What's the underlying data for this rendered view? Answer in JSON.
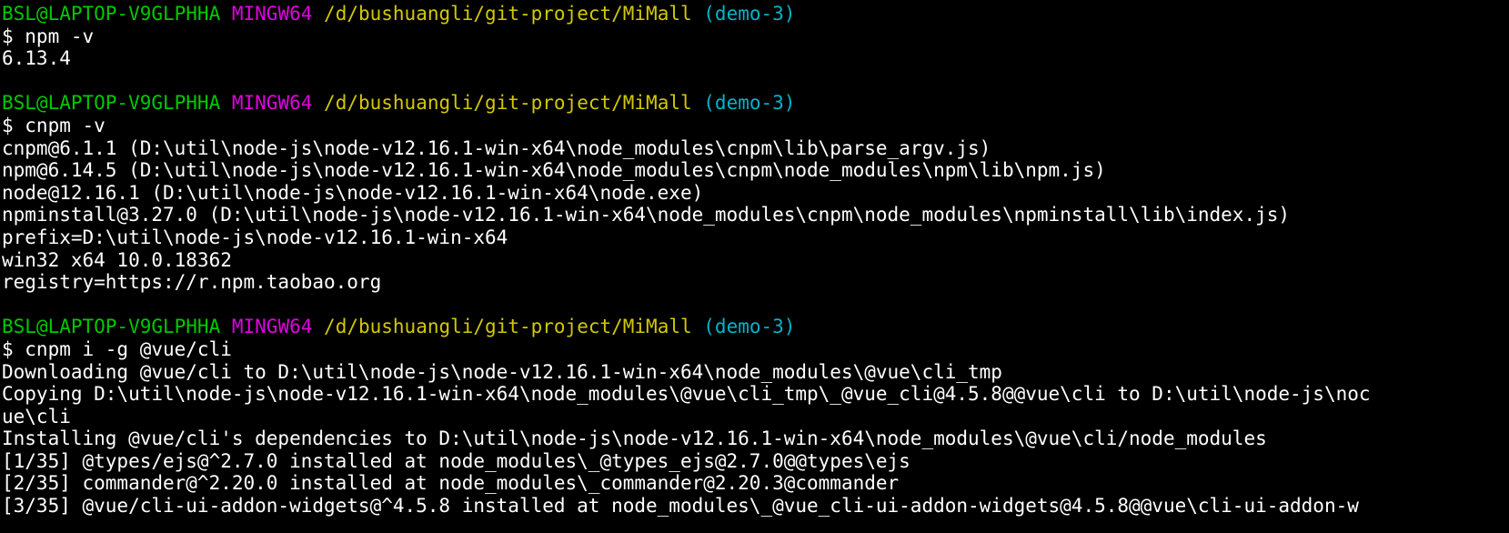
{
  "colors": {
    "background": "#000000",
    "prompt_user": "#00c800",
    "prompt_system": "#e000e0",
    "prompt_path": "#d2c800",
    "prompt_branch": "#00b4c8",
    "output_text": "#ffffff"
  },
  "blocks": [
    {
      "prompt": {
        "user": "BSL@LAPTOP-V9GLPHHA",
        "system": "MINGW64",
        "path": "/d/bushuangli/git-project/MiMall",
        "branch": "(demo-3)"
      },
      "command": "$ npm -v",
      "output": [
        "6.13.4"
      ]
    },
    {
      "prompt": {
        "user": "BSL@LAPTOP-V9GLPHHA",
        "system": "MINGW64",
        "path": "/d/bushuangli/git-project/MiMall",
        "branch": "(demo-3)"
      },
      "command": "$ cnpm -v",
      "output": [
        "cnpm@6.1.1 (D:\\util\\node-js\\node-v12.16.1-win-x64\\node_modules\\cnpm\\lib\\parse_argv.js)",
        "npm@6.14.5 (D:\\util\\node-js\\node-v12.16.1-win-x64\\node_modules\\cnpm\\node_modules\\npm\\lib\\npm.js)",
        "node@12.16.1 (D:\\util\\node-js\\node-v12.16.1-win-x64\\node.exe)",
        "npminstall@3.27.0 (D:\\util\\node-js\\node-v12.16.1-win-x64\\node_modules\\cnpm\\node_modules\\npminstall\\lib\\index.js)",
        "prefix=D:\\util\\node-js\\node-v12.16.1-win-x64",
        "win32 x64 10.0.18362",
        "registry=https://r.npm.taobao.org"
      ]
    },
    {
      "prompt": {
        "user": "BSL@LAPTOP-V9GLPHHA",
        "system": "MINGW64",
        "path": "/d/bushuangli/git-project/MiMall",
        "branch": "(demo-3)"
      },
      "command": "$ cnpm i -g @vue/cli",
      "output": [
        "Downloading @vue/cli to D:\\util\\node-js\\node-v12.16.1-win-x64\\node_modules\\@vue\\cli_tmp",
        "Copying D:\\util\\node-js\\node-v12.16.1-win-x64\\node_modules\\@vue\\cli_tmp\\_@vue_cli@4.5.8@@vue\\cli to D:\\util\\node-js\\noc",
        "ue\\cli",
        "Installing @vue/cli's dependencies to D:\\util\\node-js\\node-v12.16.1-win-x64\\node_modules\\@vue\\cli/node_modules",
        "[1/35] @types/ejs@^2.7.0 installed at node_modules\\_@types_ejs@2.7.0@@types\\ejs",
        "[2/35] commander@^2.20.0 installed at node_modules\\_commander@2.20.3@commander",
        "[3/35] @vue/cli-ui-addon-widgets@^4.5.8 installed at node_modules\\_@vue_cli-ui-addon-widgets@4.5.8@@vue\\cli-ui-addon-w"
      ]
    }
  ]
}
